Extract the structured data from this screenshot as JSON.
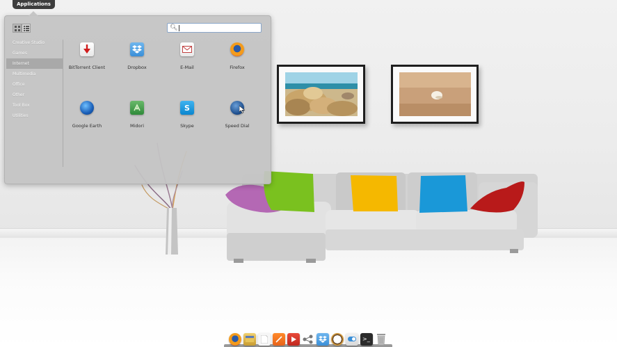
{
  "top_bar": {
    "applications_label": "Applications"
  },
  "launcher": {
    "view_modes": [
      "grid-view",
      "list-view"
    ],
    "search": {
      "value": "",
      "placeholder": ""
    },
    "categories": [
      {
        "label": "Creative Studio"
      },
      {
        "label": "Games"
      },
      {
        "label": "Internet",
        "selected": true
      },
      {
        "label": "Multimedia"
      },
      {
        "label": "Office"
      },
      {
        "label": "Other"
      },
      {
        "label": "Tool Box"
      },
      {
        "label": "Utilities"
      }
    ],
    "apps": [
      {
        "label": "BitTorrent Client",
        "icon": "bittorrent-icon"
      },
      {
        "label": "Dropbox",
        "icon": "dropbox-icon"
      },
      {
        "label": "E-Mail",
        "icon": "email-icon"
      },
      {
        "label": "Firefox",
        "icon": "firefox-icon"
      },
      {
        "label": "Google Earth",
        "icon": "google-earth-icon"
      },
      {
        "label": "Midori",
        "icon": "midori-icon"
      },
      {
        "label": "Skype",
        "icon": "skype-icon"
      },
      {
        "label": "Speed Dial",
        "icon": "speed-dial-icon"
      }
    ]
  },
  "dock": {
    "items": [
      {
        "icon": "firefox-icon"
      },
      {
        "icon": "file-manager-icon"
      },
      {
        "icon": "text-editor-icon"
      },
      {
        "icon": "graphics-icon"
      },
      {
        "icon": "video-player-icon"
      },
      {
        "icon": "network-icon"
      },
      {
        "icon": "dropbox-icon"
      },
      {
        "icon": "clock-icon"
      },
      {
        "icon": "settings-toggle-icon"
      },
      {
        "icon": "terminal-icon"
      },
      {
        "icon": "trash-icon"
      }
    ]
  },
  "colors": {
    "accent_search_border": "#8aa6c9",
    "pillow_purple": "#b468b4",
    "pillow_green": "#7ac11f",
    "pillow_yellow": "#f5b800",
    "pillow_blue": "#1a98d8",
    "pillow_red": "#b81a1a"
  }
}
